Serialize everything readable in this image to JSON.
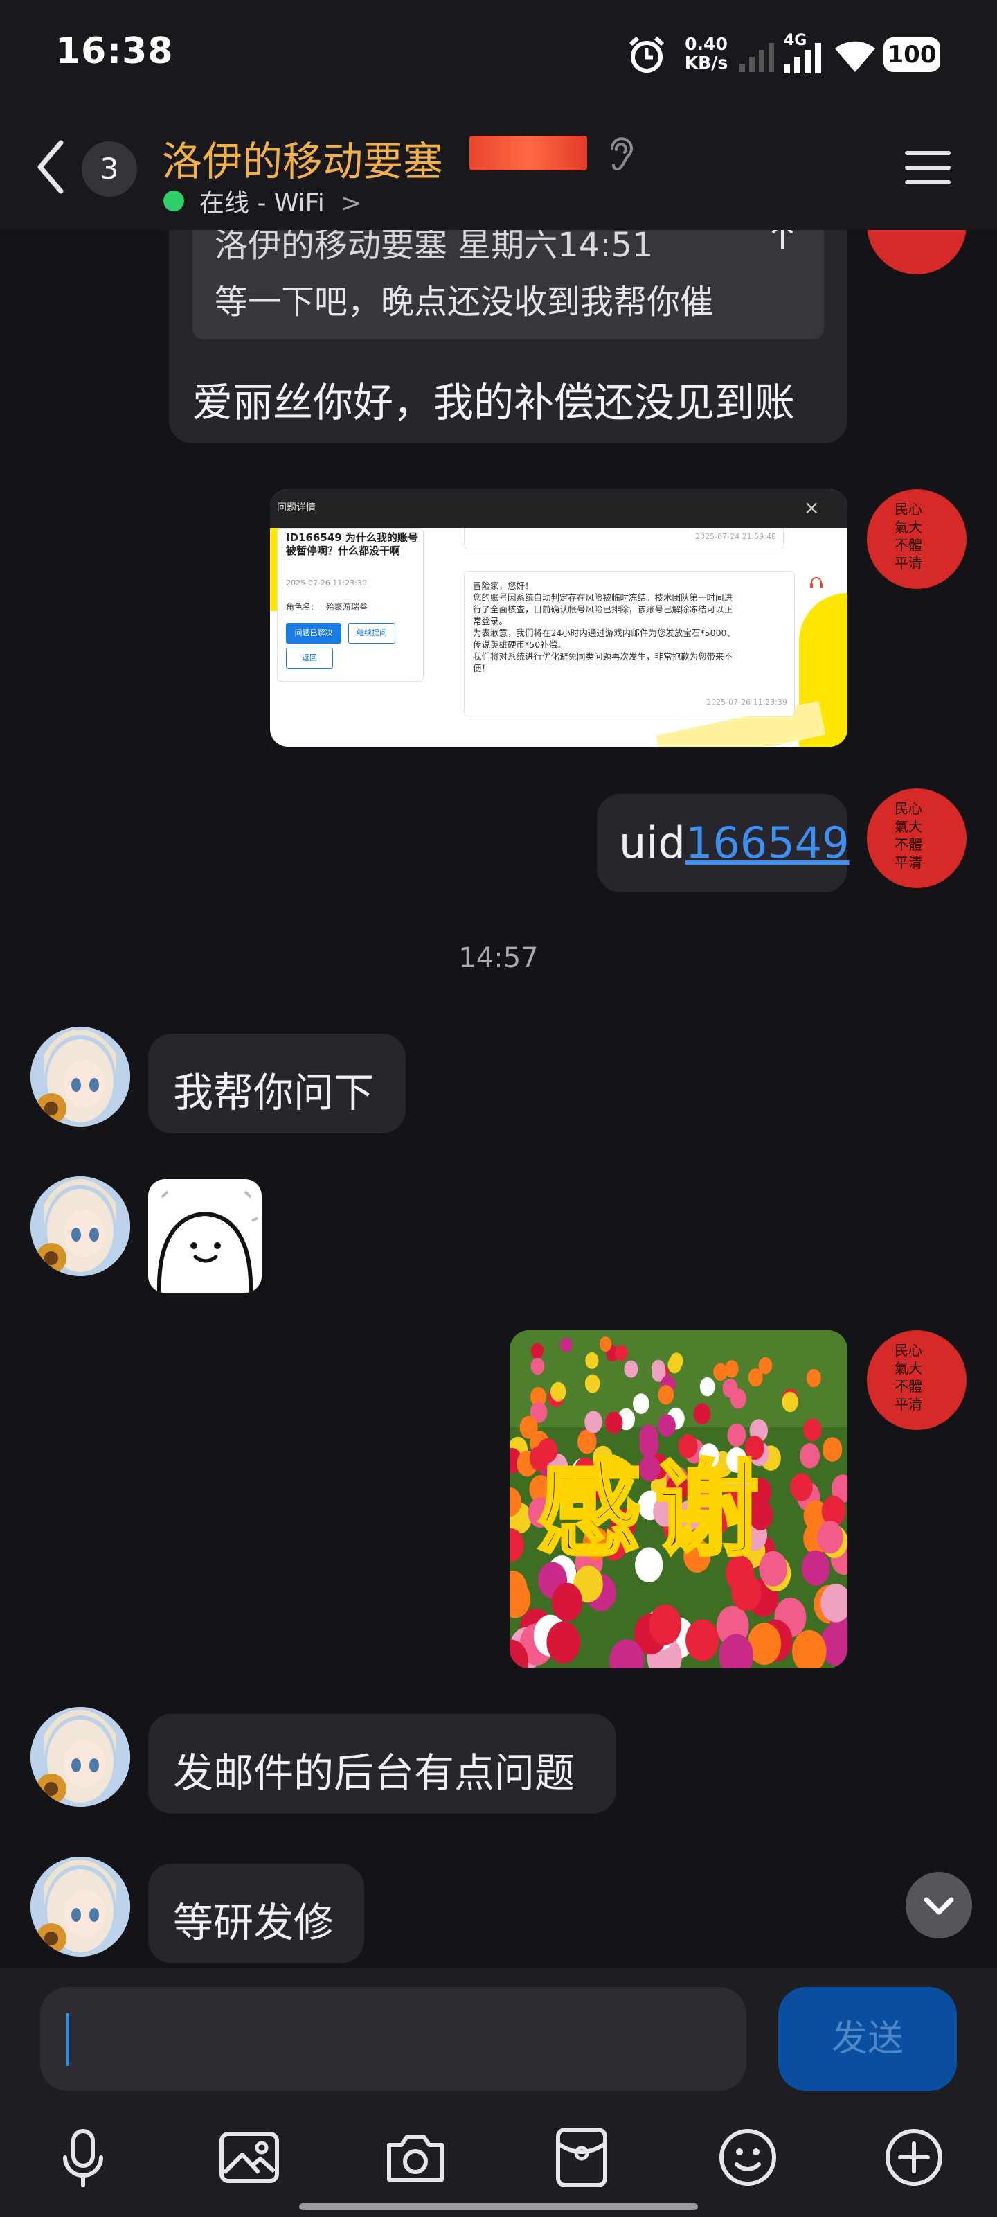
{
  "status_bar": {
    "time": "16:38",
    "net_speed_value": "0.40",
    "net_speed_unit": "KB/s",
    "network_type": "4G",
    "battery": "100"
  },
  "header": {
    "unread_count": "3",
    "title": "洛伊的移动要塞",
    "status": "在线 - WiFi",
    "status_chevron": ">"
  },
  "messages": {
    "reply": {
      "quoted_header": "洛伊的移动要塞 星期六14:51",
      "quoted_text": "等一下吧，晚点还没收到我帮你催",
      "text": "爱丽丝你好，我的补偿还没见到账"
    },
    "screenshot": {
      "title": "问题详情",
      "close": "×",
      "ticket_title": "ID166549 为什么我的账号被暂停啊？什么都没干啊",
      "ticket_time": "2025-07-26 11:23:39",
      "role_label": "角色名:",
      "role_name": "殆聚游瑞叁",
      "button_resolved": "问题已解决",
      "button_continue": "继续提问",
      "button_back": "返回",
      "prev_time": "2025-07-24 21:59:48",
      "reply_lines": [
        "冒险家，您好！",
        "您的账号因系统自动判定存在风险被临时冻结。技术团队第一时间进",
        "行了全面核查，目前确认帐号风险已排除，该账号已解除冻结可以正",
        "常登录。",
        "为表歉意，我们将在24小时内通过游戏内邮件为您发放宝石*5000、",
        "传说英雄硬币*50补偿。",
        "我们将对系统进行优化避免同类问题再次发生，非常抱歉为您带来不",
        "便！"
      ],
      "reply_time": "2025-07-26 11:23:39"
    },
    "uid": {
      "prefix": "uid",
      "number": "166549"
    },
    "time_divider": "14:57",
    "msg1": "我帮你问下",
    "thanks_sticker_text": "感谢",
    "msg2": "发邮件的后台有点问题",
    "msg3": "等研发修"
  },
  "avatar_seal_text": "心大體清 民氣不平",
  "input": {
    "placeholder": "",
    "send_label": "发送"
  },
  "toolbar": [
    "mic-icon",
    "image-icon",
    "camera-icon",
    "red-packet-icon",
    "emoji-icon",
    "plus-icon"
  ],
  "colors": {
    "background": "#131318",
    "bubble": "#26262c",
    "title": "#f2b04a",
    "link": "#3f8ff0",
    "online": "#2fcf6a",
    "send_button": "#0a4ea0",
    "my_avatar": "#d52a28"
  }
}
